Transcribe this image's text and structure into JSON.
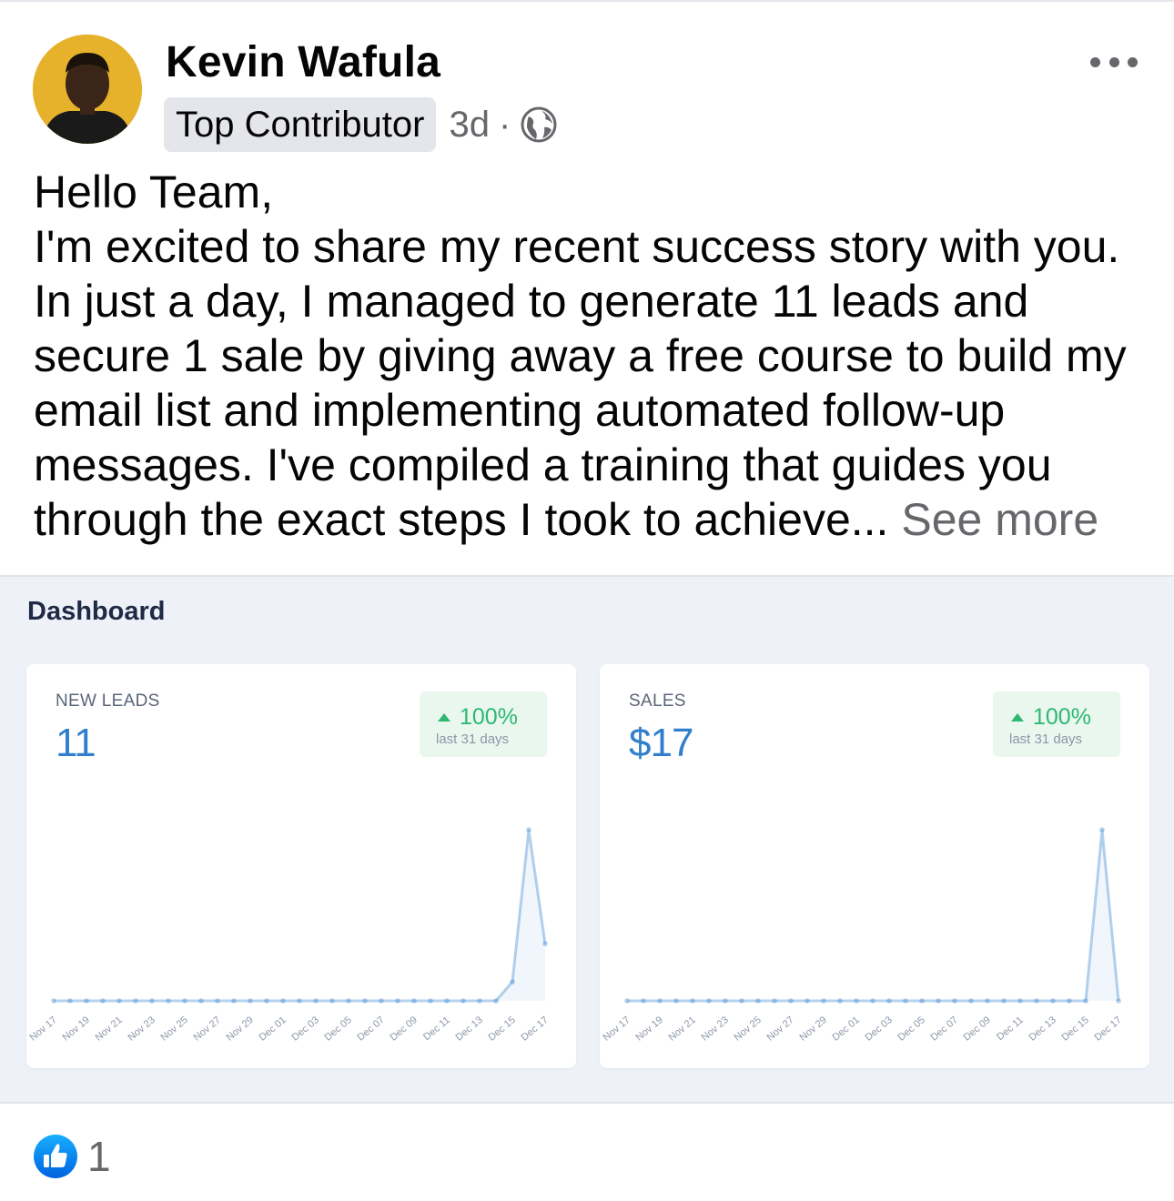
{
  "post": {
    "author": "Kevin Wafula",
    "badge": "Top Contributor",
    "time": "3d",
    "separator": "·",
    "privacy_icon": "globe-icon",
    "more_icon": "more-horizontal-icon",
    "greeting": "Hello Team,",
    "body": "I'm excited to share my recent success story with you. In just a day, I managed to generate 11 leads and secure 1 sale by giving away a free course to build my email list and implementing automated follow-up messages. I've compiled a training that guides you through the exact steps I took to achieve...",
    "see_more": "See more"
  },
  "dashboard": {
    "title": "Dashboard",
    "accent": "#2f7fcc",
    "positive": "#2eb872",
    "cards": [
      {
        "label": "NEW LEADS",
        "value": "11",
        "change": "100%",
        "period": "last 31 days"
      },
      {
        "label": "SALES",
        "value": "$17",
        "change": "100%",
        "period": "last 31 days"
      }
    ]
  },
  "chart_data": [
    {
      "type": "area",
      "title": "NEW LEADS",
      "x": [
        "Nov 17",
        "Nov 18",
        "Nov 19",
        "Nov 20",
        "Nov 21",
        "Nov 22",
        "Nov 23",
        "Nov 24",
        "Nov 25",
        "Nov 26",
        "Nov 27",
        "Nov 28",
        "Nov 29",
        "Nov 30",
        "Dec 01",
        "Dec 02",
        "Dec 03",
        "Dec 04",
        "Dec 05",
        "Dec 06",
        "Dec 07",
        "Dec 08",
        "Dec 09",
        "Dec 10",
        "Dec 11",
        "Dec 12",
        "Dec 13",
        "Dec 14",
        "Dec 15",
        "Dec 16",
        "Dec 17"
      ],
      "tick_labels": [
        "Nov 17",
        "Nov 19",
        "Nov 21",
        "Nov 23",
        "Nov 25",
        "Nov 27",
        "Nov 29",
        "Dec 01",
        "Dec 03",
        "Dec 05",
        "Dec 07",
        "Dec 09",
        "Dec 11",
        "Dec 13",
        "Dec 15",
        "Dec 17"
      ],
      "values": [
        0,
        0,
        0,
        0,
        0,
        0,
        0,
        0,
        0,
        0,
        0,
        0,
        0,
        0,
        0,
        0,
        0,
        0,
        0,
        0,
        0,
        0,
        0,
        0,
        0,
        0,
        0,
        0,
        1,
        9,
        3
      ],
      "ylim": [
        0,
        9
      ],
      "grid": false
    },
    {
      "type": "area",
      "title": "SALES",
      "x": [
        "Nov 17",
        "Nov 18",
        "Nov 19",
        "Nov 20",
        "Nov 21",
        "Nov 22",
        "Nov 23",
        "Nov 24",
        "Nov 25",
        "Nov 26",
        "Nov 27",
        "Nov 28",
        "Nov 29",
        "Nov 30",
        "Dec 01",
        "Dec 02",
        "Dec 03",
        "Dec 04",
        "Dec 05",
        "Dec 06",
        "Dec 07",
        "Dec 08",
        "Dec 09",
        "Dec 10",
        "Dec 11",
        "Dec 12",
        "Dec 13",
        "Dec 14",
        "Dec 15",
        "Dec 16",
        "Dec 17"
      ],
      "tick_labels": [
        "Nov 17",
        "Nov 19",
        "Nov 21",
        "Nov 23",
        "Nov 25",
        "Nov 27",
        "Nov 29",
        "Dec 01",
        "Dec 03",
        "Dec 05",
        "Dec 07",
        "Dec 09",
        "Dec 11",
        "Dec 13",
        "Dec 15",
        "Dec 17"
      ],
      "values": [
        0,
        0,
        0,
        0,
        0,
        0,
        0,
        0,
        0,
        0,
        0,
        0,
        0,
        0,
        0,
        0,
        0,
        0,
        0,
        0,
        0,
        0,
        0,
        0,
        0,
        0,
        0,
        0,
        0,
        17,
        0
      ],
      "ylim": [
        0,
        17
      ],
      "grid": false
    }
  ],
  "reactions": {
    "icon": "like-icon",
    "count": "1"
  }
}
